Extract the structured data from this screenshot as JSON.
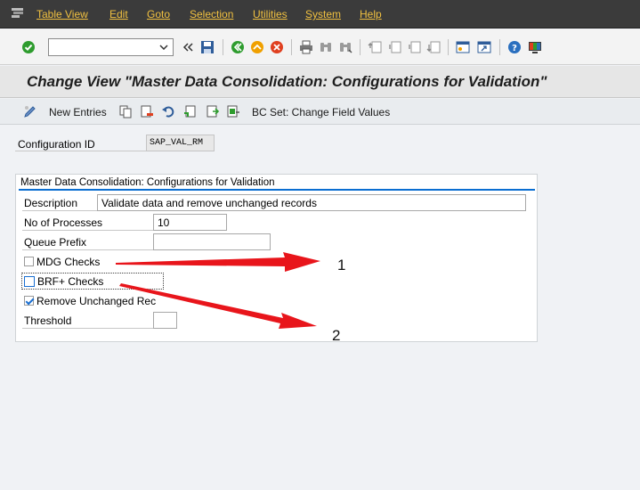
{
  "menubar": {
    "items": [
      "Table View",
      "Edit",
      "Goto",
      "Selection",
      "Utilities",
      "System",
      "Help"
    ]
  },
  "toolbar": {
    "command_field_value": "",
    "icons": [
      "enter-icon",
      "command-dropdown-icon",
      "back-arrows-icon",
      "save-icon",
      "back-icon",
      "exit-icon",
      "cancel-icon",
      "print-icon",
      "find-icon",
      "find-next-icon",
      "first-page-icon",
      "previous-page-icon",
      "next-page-icon",
      "last-page-icon",
      "create-session-icon",
      "shortcut-icon",
      "help-icon",
      "layout-menu-icon"
    ],
    "colors": {
      "enter": "#2e9c2e",
      "back": "#2e9c2e",
      "exit": "#f0a000",
      "cancel": "#e04020",
      "help": "#2a6fbf"
    }
  },
  "title": "Change View \"Master Data Consolidation: Configurations for Validation\"",
  "app_toolbar": {
    "new_entries": "New Entries",
    "bc_set": "BC Set: Change Field Values",
    "icons": [
      "display-change-icon",
      "copy-icon",
      "delete-icon",
      "undo-icon",
      "select-all-icon",
      "select-block-icon",
      "deselect-all-icon"
    ]
  },
  "config": {
    "label": "Configuration ID",
    "value": "SAP_VAL_RM"
  },
  "group": {
    "title": "Master Data Consolidation: Configurations for Validation",
    "description_label": "Description",
    "description_value": "Validate data and remove unchanged records",
    "processes_label": "No of Processes",
    "processes_value": "10",
    "queue_label": "Queue Prefix",
    "queue_value": "",
    "mdg_label": "MDG Checks",
    "mdg_checked": false,
    "brf_label": "BRF+ Checks",
    "brf_checked": false,
    "remove_label": "Remove Unchanged Rec",
    "remove_checked": true,
    "threshold_label": "Threshold",
    "threshold_value": ""
  },
  "annotations": {
    "arrow_color": "#e8151b",
    "labels": [
      "1",
      "2"
    ]
  }
}
